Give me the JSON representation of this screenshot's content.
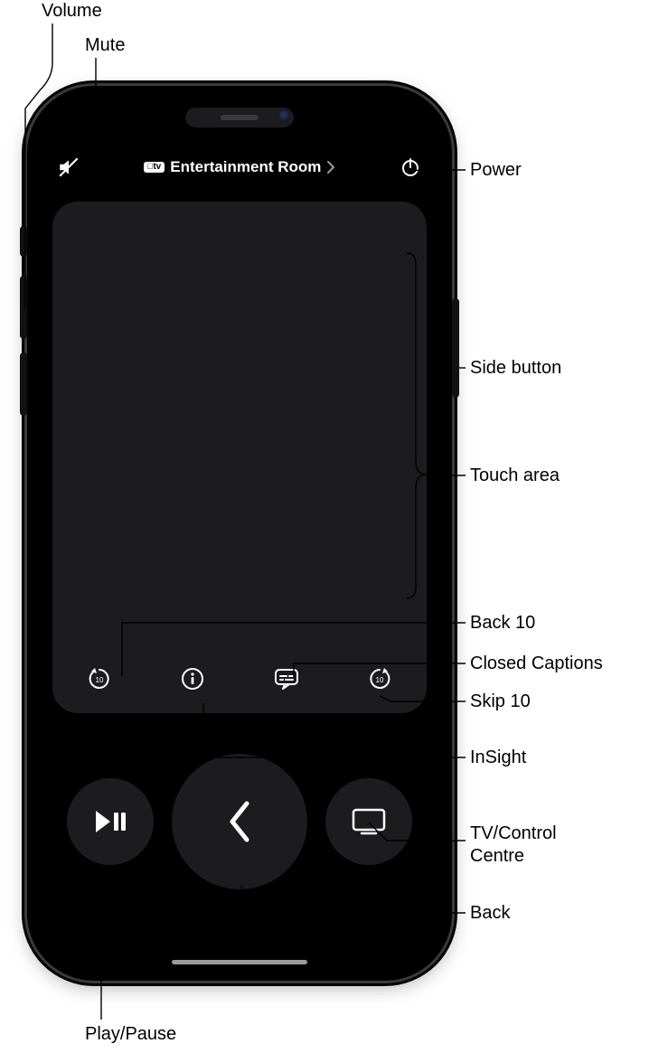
{
  "diagram": {
    "device_selector": {
      "badge": "tv",
      "name": "Entertainment Room"
    },
    "labels": {
      "volume": "Volume",
      "mute": "Mute",
      "power": "Power",
      "side_button": "Side button",
      "touch_area": "Touch area",
      "back_10": "Back 10",
      "closed_captions": "Closed Captions",
      "skip_10": "Skip 10",
      "insight": "InSight",
      "tv_control_centre": "TV/Control\nCentre",
      "back": "Back",
      "play_pause": "Play/Pause"
    },
    "icons": {
      "mute": "mute-icon",
      "power": "power-icon",
      "back10": "back-10-icon",
      "info": "info-icon",
      "captions": "closed-captions-icon",
      "skip10": "skip-10-icon",
      "play_pause": "play-pause-icon",
      "back_chevron": "chevron-left-icon",
      "tv": "tv-icon",
      "chevron_right": "chevron-right-icon"
    }
  }
}
